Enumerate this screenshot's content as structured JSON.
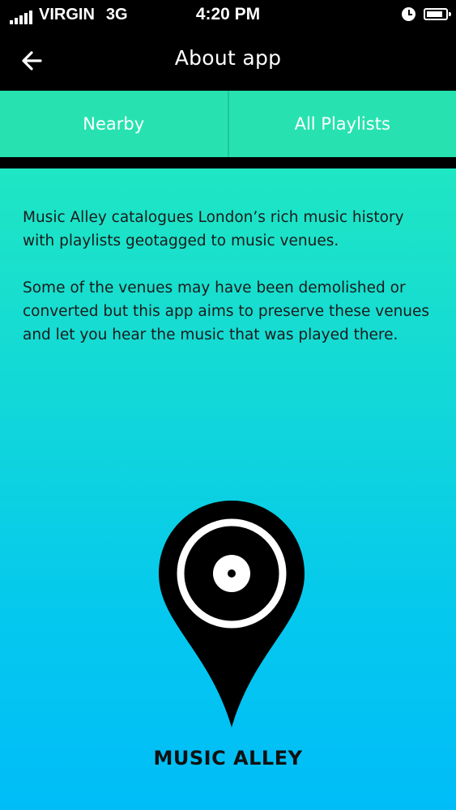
{
  "status_bar": {
    "carrier": "VIRGIN",
    "network": "3G",
    "time": "4:20 PM",
    "signal_bars": 5,
    "battery_level": 0.85
  },
  "header": {
    "title": "About app",
    "back_icon": "arrow-left-icon"
  },
  "tabs": [
    {
      "label": "Nearby"
    },
    {
      "label": "All Playlists"
    }
  ],
  "about": {
    "paragraphs": [
      "Music Alley catalogues London’s rich music history with playlists geotagged to music venues.",
      "Some of the venues may have been demolished or converted but this app aims to preserve these venues and let you hear the music that was played there."
    ]
  },
  "brand": {
    "name": "MUSIC ALLEY",
    "logo_icon": "vinyl-map-pin-icon"
  },
  "colors": {
    "tab_background": "#27e2b0",
    "gradient_top": "#1fe6c3",
    "gradient_bottom": "#00bdf8",
    "bars": "#000000",
    "text": "#1b1b1b"
  }
}
